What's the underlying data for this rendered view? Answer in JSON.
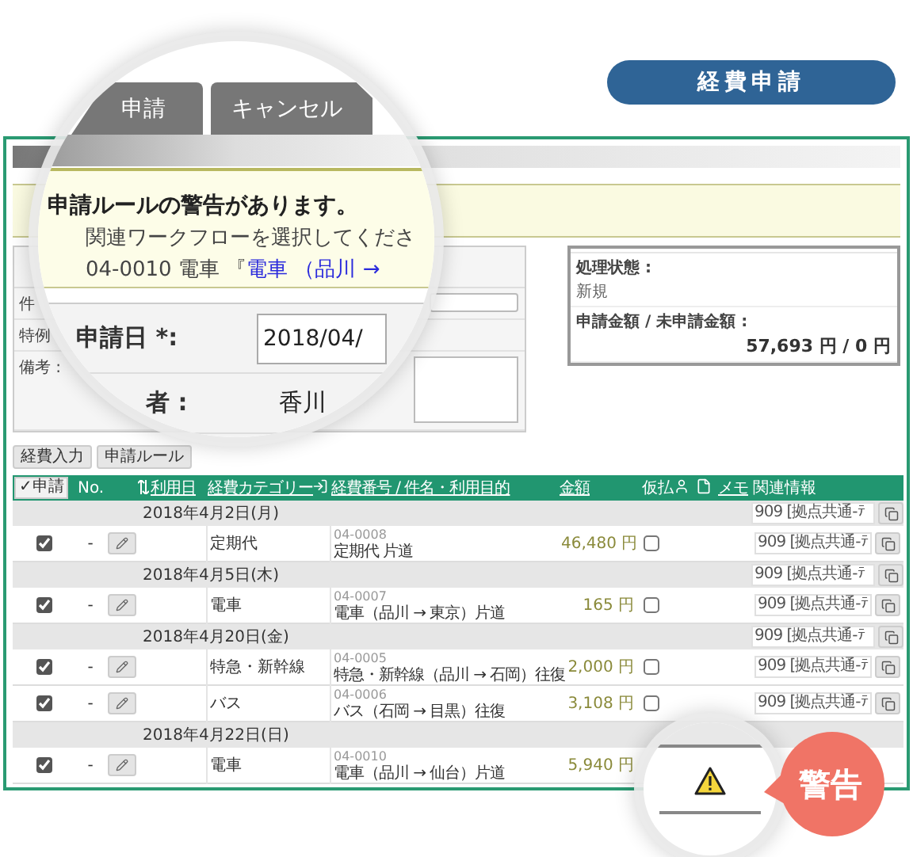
{
  "header_badge": "経費申請",
  "magnifier": {
    "tabs": [
      {
        "label": "申請"
      },
      {
        "label": "キャンセル"
      }
    ],
    "warning": {
      "title": "申請ルールの警告があります。",
      "line": "関連ワークフローを選択してくださ",
      "ref_prefix": "04-0010 電車 『",
      "ref_link": "電車 （品川 →"
    },
    "fields": [
      {
        "kind": "input",
        "label": "申請日 *:",
        "value": "2018/04/"
      },
      {
        "kind": "text",
        "label": "者 :",
        "value": "香川"
      }
    ]
  },
  "form": {
    "labels": [
      "件",
      "特例",
      "備考 :"
    ]
  },
  "status": {
    "state_label": "処理状態 :",
    "state": "新規",
    "amount_label": "申請金額 / 未申請金額 :",
    "amount": "57,693 円 / 0 円"
  },
  "buttons": [
    "経費入力",
    "申請ルール"
  ],
  "table": {
    "columns": [
      {
        "kind": "button",
        "label": "✓申請"
      },
      {
        "kind": "text",
        "label": "No."
      },
      {
        "kind": "blank"
      },
      {
        "kind": "sort",
        "label": "利用日"
      },
      {
        "kind": "link",
        "label": "経費カテゴリー"
      },
      {
        "kind": "icon"
      },
      {
        "kind": "link",
        "label": "経費番号 / 件名・利用目的"
      },
      {
        "kind": "link",
        "label": "金額"
      },
      {
        "kind": "text",
        "label": "仮払"
      },
      {
        "kind": "icon"
      },
      {
        "kind": "icon"
      },
      {
        "kind": "link",
        "label": "メモ"
      },
      {
        "kind": "text",
        "label": "関連情報"
      }
    ],
    "rows": [
      {
        "kind": "group",
        "date": "2018年4月2日(月)",
        "related": "909 [拠点共通-ﾃ"
      },
      {
        "kind": "item",
        "checked": true,
        "no": "-",
        "category": "定期代",
        "number": "04-0008",
        "title": "定期代 片道",
        "amount": "46,480 円",
        "advance": false,
        "related": "909 [拠点共通-ﾃ"
      },
      {
        "kind": "group",
        "date": "2018年4月5日(木)",
        "related": "909 [拠点共通-ﾃ"
      },
      {
        "kind": "item",
        "checked": true,
        "no": "-",
        "category": "電車",
        "number": "04-0007",
        "title": "電車（品川 → 東京）片道",
        "amount": "165 円",
        "advance": false,
        "related": "909 [拠点共通-ﾃ"
      },
      {
        "kind": "group",
        "date": "2018年4月20日(金)",
        "related": "909 [拠点共通-ﾃ"
      },
      {
        "kind": "item",
        "checked": true,
        "no": "-",
        "category": "特急・新幹線",
        "number": "04-0005",
        "title": "特急・新幹線（品川 → 石岡）往復",
        "amount": "2,000 円",
        "advance": false,
        "related": "909 [拠点共通-ﾃ"
      },
      {
        "kind": "item",
        "checked": true,
        "no": "-",
        "category": "バス",
        "number": "04-0006",
        "title": "バス（石岡 → 目黒）往復",
        "amount": "3,108 円",
        "advance": false,
        "related": "909 [拠点共通-ﾃ"
      },
      {
        "kind": "group",
        "date": "2018年4月22日(日)"
      },
      {
        "kind": "item",
        "checked": true,
        "no": "-",
        "category": "電車",
        "number": "04-0010",
        "title": "電車（品川 → 仙台）片道",
        "amount": "5,940 円"
      }
    ]
  },
  "alert": {
    "label": "警告"
  }
}
